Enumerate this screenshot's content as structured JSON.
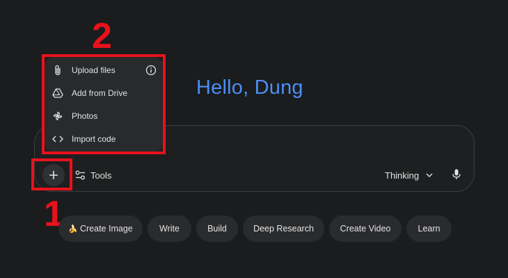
{
  "greeting": "Hello, Dung",
  "menu": {
    "items": [
      {
        "label": "Upload files",
        "icon": "paperclip-icon"
      },
      {
        "label": "Add from Drive",
        "icon": "drive-icon"
      },
      {
        "label": "Photos",
        "icon": "pinwheel-icon"
      },
      {
        "label": "Import code",
        "icon": "code-icon"
      }
    ]
  },
  "toolbar": {
    "tools_label": "Tools",
    "thinking_label": "Thinking"
  },
  "chips": [
    {
      "emoji": "🍌",
      "label": "Create Image"
    },
    {
      "label": "Write"
    },
    {
      "label": "Build"
    },
    {
      "label": "Deep Research"
    },
    {
      "label": "Create Video"
    },
    {
      "label": "Learn"
    }
  ],
  "annotations": {
    "step1": "1",
    "step2": "2",
    "color": "#e8121c"
  },
  "colors": {
    "background": "#1b1c1d",
    "greeting": "#4b8ef5"
  }
}
